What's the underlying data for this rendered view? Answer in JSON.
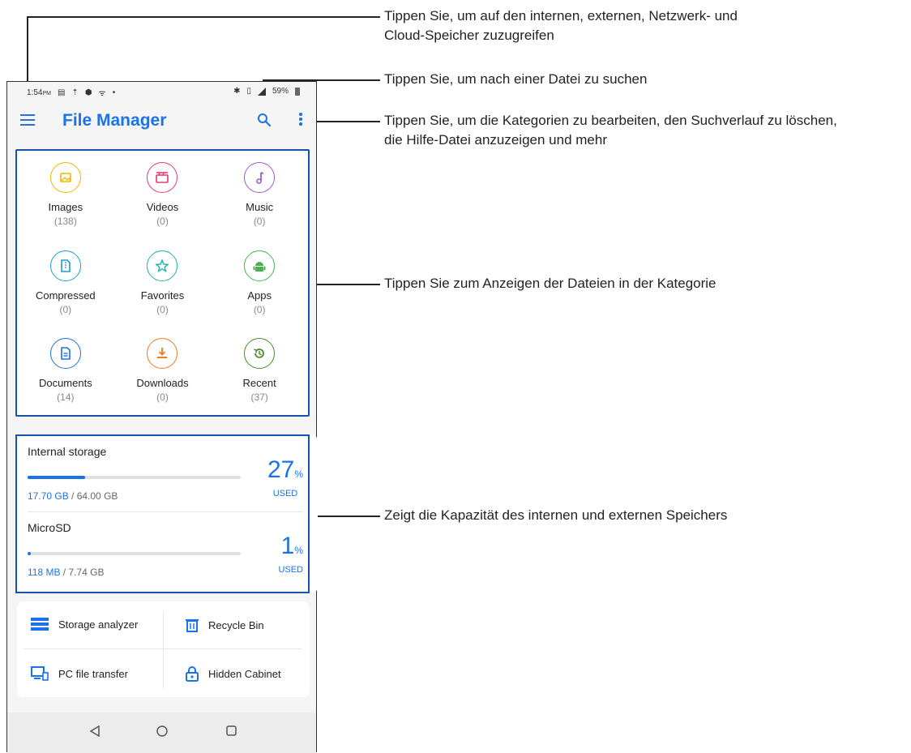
{
  "status_bar": {
    "time": "1:54",
    "ampm": "PM",
    "battery": "59%"
  },
  "app_bar": {
    "title": "File Manager"
  },
  "categories": [
    {
      "label": "Images",
      "count": "(138)",
      "icon": "image-icon",
      "color": "#f2b600"
    },
    {
      "label": "Videos",
      "count": "(0)",
      "icon": "clapperboard-icon",
      "color": "#e53975"
    },
    {
      "label": "Music",
      "count": "(0)",
      "icon": "music-note-icon",
      "color": "#a259d4"
    },
    {
      "label": "Compressed",
      "count": "(0)",
      "icon": "zip-file-icon",
      "color": "#1e9bd7"
    },
    {
      "label": "Favorites",
      "count": "(0)",
      "icon": "star-icon",
      "color": "#18b3a8"
    },
    {
      "label": "Apps",
      "count": "(0)",
      "icon": "android-icon",
      "color": "#4caf50"
    },
    {
      "label": "Documents",
      "count": "(14)",
      "icon": "document-icon",
      "color": "#1a73e8"
    },
    {
      "label": "Downloads",
      "count": "(0)",
      "icon": "download-icon",
      "color": "#e87e1a"
    },
    {
      "label": "Recent",
      "count": "(37)",
      "icon": "history-icon",
      "color": "#4a8a2c"
    }
  ],
  "storage": [
    {
      "name": "Internal storage",
      "used": "17.70 GB",
      "total": " / 64.00 GB",
      "percent": "27",
      "percent_sign": "%",
      "used_label": "USED",
      "fill_fraction": 0.27
    },
    {
      "name": "MicroSD",
      "used": "118 MB",
      "total": " / 7.74 GB",
      "percent": "1",
      "percent_sign": "%",
      "used_label": "USED",
      "fill_fraction": 0.015
    }
  ],
  "tools": {
    "storage_analyzer": "Storage analyzer",
    "recycle_bin": "Recycle Bin",
    "pc_file_transfer": "PC file transfer",
    "hidden_cabinet": "Hidden Cabinet"
  },
  "callouts": {
    "menu": "Tippen Sie, um auf den internen, externen, Netzwerk- und",
    "menu_line2": "Cloud-Speicher zuzugreifen",
    "search": "Tippen Sie, um nach einer Datei zu suchen",
    "more": "Tippen Sie, um die Kategorien zu bearbeiten, den Suchverlauf zu löschen,",
    "more_line2": "die Hilfe-Datei anzuzeigen und mehr",
    "categories": "Tippen Sie zum Anzeigen der Dateien in der Kategorie",
    "storage": "Zeigt die Kapazität des internen und externen Speichers"
  },
  "colors": {
    "accent": "#1a73e8",
    "callout_frame": "#1652a8"
  }
}
